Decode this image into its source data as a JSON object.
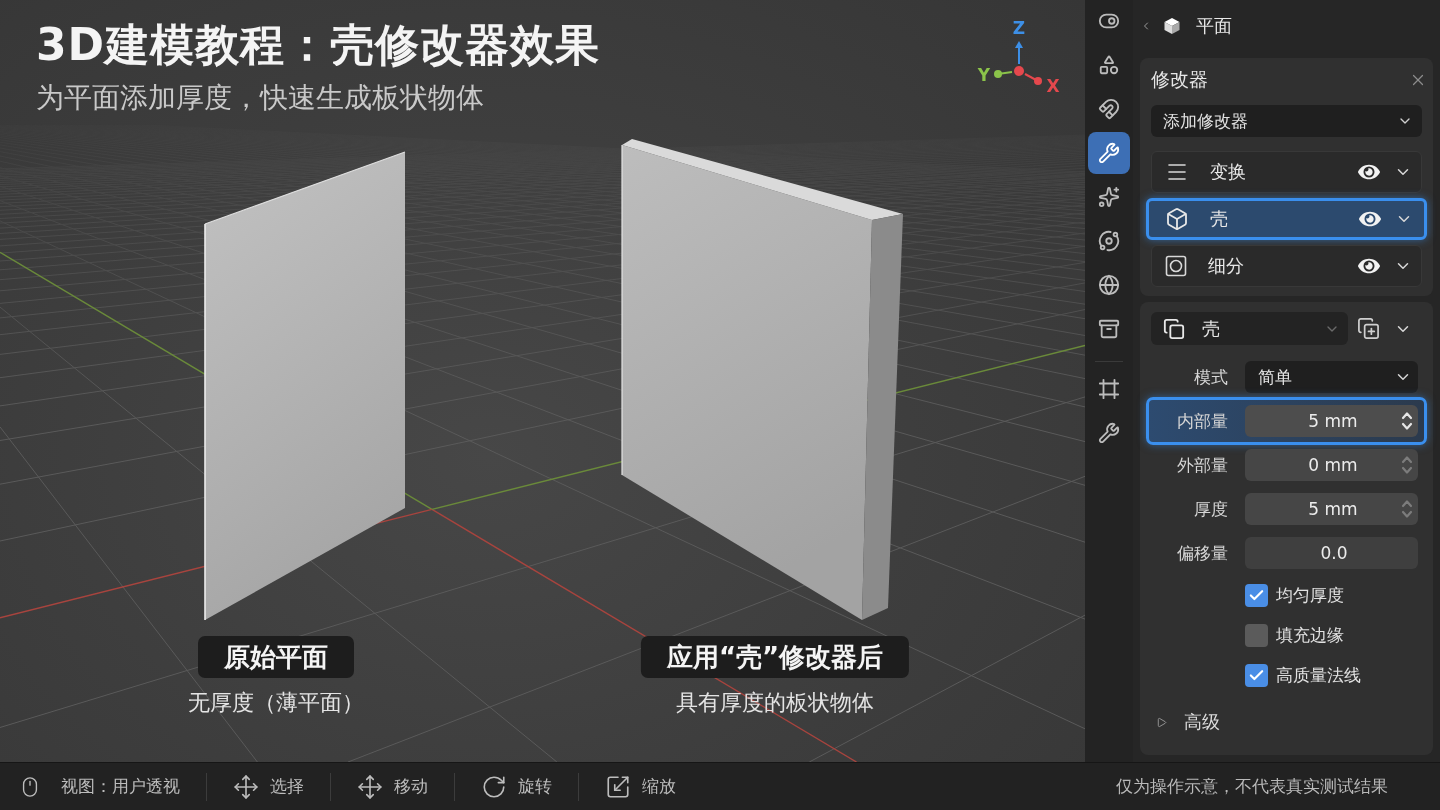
{
  "viewport": {
    "title": "3D建模教程：壳修改器效果",
    "subtitle": "为平面添加厚度，快速生成板状物体",
    "gizmo": [
      {
        "label": "Z",
        "color": "#3d8fe6"
      },
      {
        "label": "Y",
        "color": "#8bc34a"
      },
      {
        "label": "X",
        "color": "#e5484d"
      }
    ],
    "captions": [
      {
        "title": "原始平面",
        "note": "无厚度（薄平面）"
      },
      {
        "title": "应用“壳”修改器后",
        "note": "具有厚度的板状物体"
      }
    ]
  },
  "properties": {
    "tab_groups": [
      {
        "tabs": [
          {
            "selected": false
          },
          {
            "selected": false
          },
          {
            "selected": false
          },
          {
            "selected": true
          },
          {
            "selected": false
          },
          {
            "selected": false
          },
          {
            "selected": false
          },
          {
            "selected": false
          }
        ]
      },
      {
        "tabs": [
          {
            "selected": false
          },
          {
            "selected": false
          }
        ]
      }
    ],
    "breadcrumb": "平面",
    "modifiers": {
      "title": "修改器",
      "add_label": "添加修改器",
      "stack": [
        {
          "name": "变换",
          "selected": false,
          "visible": true
        },
        {
          "name": "壳",
          "selected": true,
          "visible": true
        },
        {
          "name": "细分",
          "selected": false,
          "visible": true
        }
      ]
    },
    "shell": {
      "name": "壳",
      "fields": [
        {
          "kind": "dropdown",
          "label": "模式",
          "value": "简单",
          "selected": false
        },
        {
          "kind": "number",
          "label": "内部量",
          "value": "5 mm",
          "selected": true,
          "spinner": true
        },
        {
          "kind": "number",
          "label": "外部量",
          "value": "0 mm",
          "selected": false,
          "spinner": true
        },
        {
          "kind": "number",
          "label": "厚度",
          "value": "5 mm",
          "selected": false,
          "spinner": true
        },
        {
          "kind": "number",
          "label": "偏移量",
          "value": "0.0",
          "selected": false,
          "spinner": false
        }
      ],
      "options": [
        {
          "label": "均匀厚度",
          "checked": true
        },
        {
          "label": "填充边缘",
          "checked": false
        },
        {
          "label": "高质量法线",
          "checked": true
        }
      ],
      "advanced": {
        "label": "高级",
        "expanded": false
      }
    }
  },
  "status_bar": {
    "hints": [
      {
        "label": "视图：用户透视"
      },
      {
        "label": "选择"
      },
      {
        "label": "移动"
      },
      {
        "label": "旋转"
      },
      {
        "label": "缩放"
      }
    ],
    "note": "仅为操作示意，不代表真实测试结果"
  }
}
